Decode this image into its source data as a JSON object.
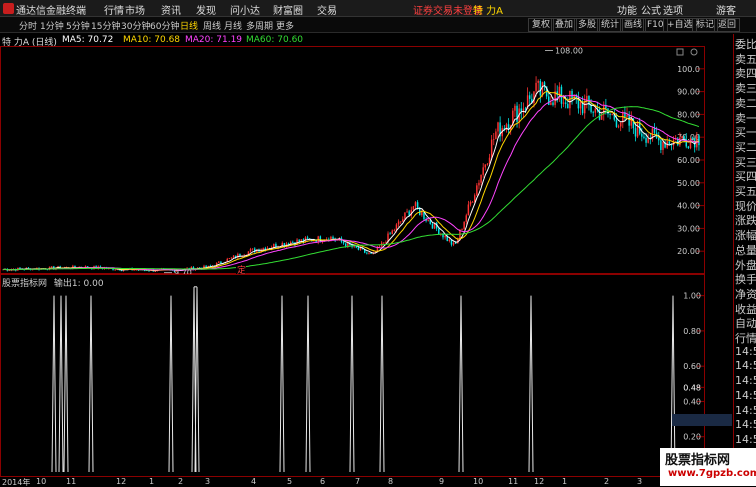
{
  "titlebar": {
    "app_title": "通达信金融终端",
    "menus": [
      "行情",
      "市场",
      "资讯",
      "发现",
      "问小达",
      "财富圈",
      "交易"
    ],
    "notice": "证券交易未登录",
    "stock_name": "特 力A",
    "right_menus": [
      "功能",
      "公式",
      "选项"
    ],
    "guest": "游客"
  },
  "toolbar": {
    "periods": [
      "分时",
      "1分钟",
      "5分钟",
      "15分钟",
      "30分钟",
      "60分钟",
      "日线",
      "周线",
      "月线",
      "多周期",
      "更多"
    ],
    "active_period": "日线",
    "buttons": [
      "复权",
      "叠加",
      "多股",
      "统计",
      "画线",
      "F10",
      "+自选",
      "标记",
      "返回"
    ]
  },
  "info": {
    "stock_label": "特 力A (日线)",
    "ma5": "MA5: 70.72",
    "ma10": "MA10: 70.68",
    "ma20": "MA20: 71.19",
    "ma60": "MA60: 70.60",
    "colors": {
      "ma5": "#ffffff",
      "ma10": "#ffd700",
      "ma20": "#ff44ff",
      "ma60": "#33dd33",
      "up": "#ff3333",
      "down": "#00e5e5"
    }
  },
  "main_chart": {
    "price_axis": [
      "100.0",
      "90.00",
      "80.00",
      "70.00",
      "60.00",
      "50.00",
      "40.00",
      "30.00",
      "20.00"
    ],
    "high_label": "108.00",
    "low_label": "9.70",
    "marker": "定"
  },
  "sub_chart": {
    "title": "股票指标网",
    "output": "输出1: 0.00",
    "axis": [
      "1.00",
      "0.80",
      "0.60",
      "0.48",
      "0.40",
      "0.20"
    ],
    "current_value": "0.48"
  },
  "date_axis": {
    "labels": [
      "2014年",
      "10",
      "11",
      "12",
      "1",
      "2",
      "3",
      "4",
      "5",
      "6",
      "7",
      "8",
      "9",
      "10",
      "11",
      "12",
      "1",
      "2",
      "3"
    ]
  },
  "right_panel": {
    "items": [
      "委比",
      "卖五",
      "卖四",
      "卖三",
      "卖二",
      "卖一",
      "买一",
      "买二",
      "买三",
      "买四",
      "买五",
      "现价",
      "涨跌",
      "涨幅",
      "总量",
      "外盘",
      "换手",
      "净资",
      "收益",
      "自动",
      "行情",
      "14:5",
      "14:5",
      "14:5",
      "14:5",
      "14:5",
      "14:5",
      "14:5",
      "14:5",
      "14:5"
    ]
  },
  "watermark": {
    "line1": "股票指标网",
    "line2": "www.7gpzb.com"
  },
  "chart_data": [
    {
      "type": "candlestick",
      "title": "特 力A (日线)",
      "ylim": [
        10,
        110
      ],
      "x": [
        "2014-10",
        "2014-11",
        "2014-12",
        "2015-01",
        "2015-02",
        "2015-03",
        "2015-04",
        "2015-05",
        "2015-06",
        "2015-07",
        "2015-08",
        "2015-09",
        "2015-10",
        "2015-11",
        "2015-12",
        "2016-01",
        "2016-02",
        "2016-03"
      ],
      "close": [
        12,
        12.5,
        13,
        12,
        11.5,
        13,
        20,
        24,
        26,
        18,
        40,
        22,
        72,
        90,
        85,
        78,
        68,
        70
      ],
      "high_label": 108.0,
      "low_label": 9.7
    },
    {
      "type": "line",
      "title": "股票指标网",
      "ylim": [
        0,
        1.1
      ],
      "x": [
        "2014-10",
        "2014-11",
        "2014-12",
        "2015-01",
        "2015-02",
        "2015-03",
        "2015-04",
        "2015-05",
        "2015-06",
        "2015-07",
        "2015-08",
        "2015-09",
        "2015-10",
        "2015-11",
        "2015-12",
        "2016-01",
        "2016-02",
        "2016-03"
      ],
      "values": [
        1,
        1,
        1,
        0,
        1,
        1,
        0,
        1,
        1,
        1,
        1,
        0,
        1,
        1,
        0,
        0,
        0,
        1
      ],
      "current": 0.0
    }
  ]
}
